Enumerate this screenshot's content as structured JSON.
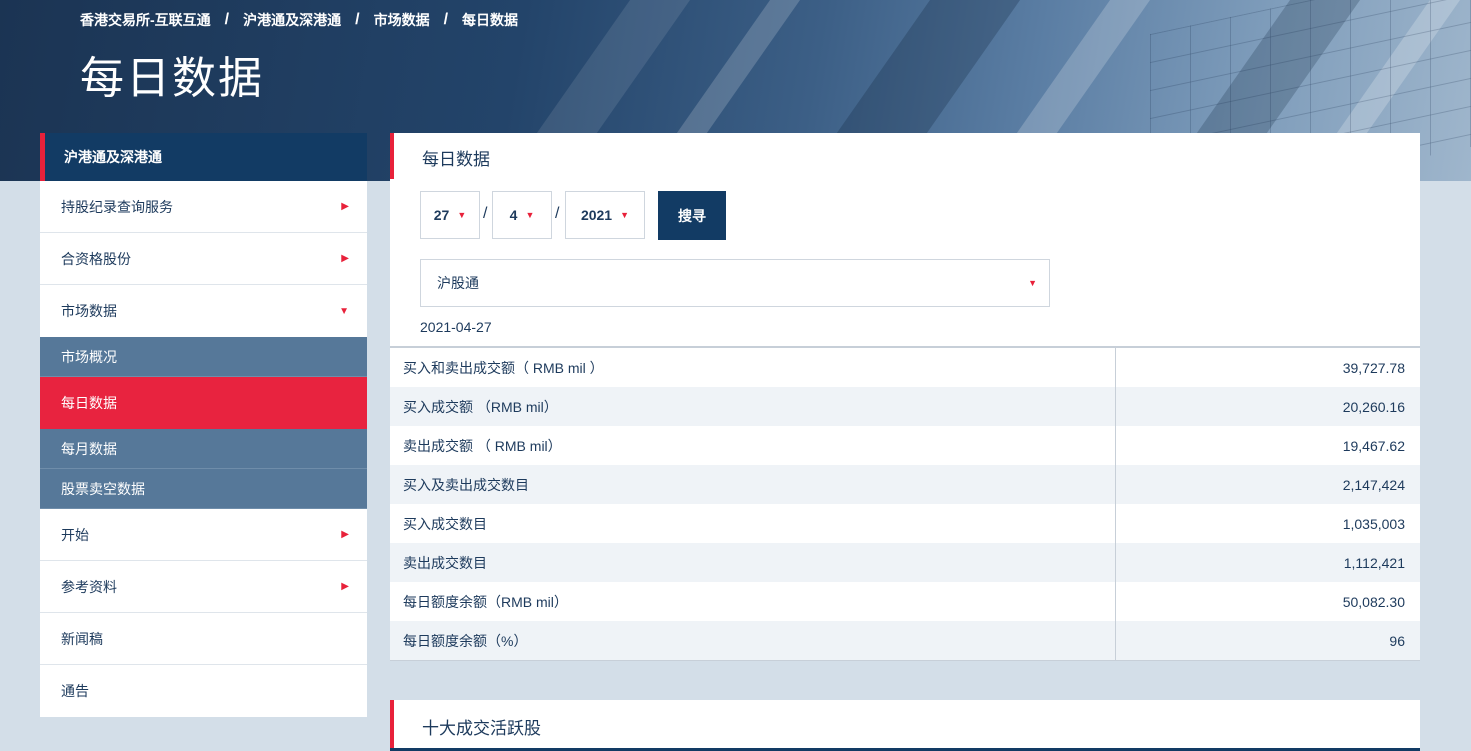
{
  "breadcrumb": [
    "香港交易所-互联互通",
    "沪港通及深港通",
    "市场数据",
    "每日数据"
  ],
  "breadcrumb_sep": "/",
  "page_title": "每日数据",
  "sidebar": {
    "header": "沪港通及深港通",
    "items": [
      {
        "label": "持股纪录查询服务",
        "arrow": "right"
      },
      {
        "label": "合资格股份",
        "arrow": "right"
      },
      {
        "label": "市场数据",
        "arrow": "down"
      }
    ],
    "sub_items": [
      {
        "label": "市场概况",
        "active": false
      },
      {
        "label": "每日数据",
        "active": true
      },
      {
        "label": "每月数据",
        "active": false
      },
      {
        "label": "股票卖空数据",
        "active": false
      }
    ],
    "items_after": [
      {
        "label": "开始",
        "arrow": "right"
      },
      {
        "label": "参考资料",
        "arrow": "right"
      },
      {
        "label": "新闻稿",
        "arrow": ""
      },
      {
        "label": "通告",
        "arrow": ""
      }
    ]
  },
  "main": {
    "title": "每日数据",
    "day": "27",
    "month": "4",
    "year": "2021",
    "search_label": "搜寻",
    "market": "沪股通",
    "data_date": "2021-04-27",
    "rows": [
      {
        "label": "买入和卖出成交额（ RMB mil ）",
        "value": "39,727.78"
      },
      {
        "label": "买入成交额 （RMB mil）",
        "value": "20,260.16"
      },
      {
        "label": "卖出成交额 （ RMB mil）",
        "value": "19,467.62"
      },
      {
        "label": "买入及卖出成交数目",
        "value": "2,147,424"
      },
      {
        "label": "买入成交数目",
        "value": "1,035,003"
      },
      {
        "label": "卖出成交数目",
        "value": "1,112,421"
      },
      {
        "label": "每日额度余额（RMB mil）",
        "value": "50,082.30"
      },
      {
        "label": "每日额度余额（%）",
        "value": "96"
      }
    ]
  },
  "section2": {
    "title": "十大成交活跃股"
  },
  "colors": {
    "navy": "#123b64",
    "accent_red": "#e8213a",
    "sub_nav": "#567899"
  }
}
